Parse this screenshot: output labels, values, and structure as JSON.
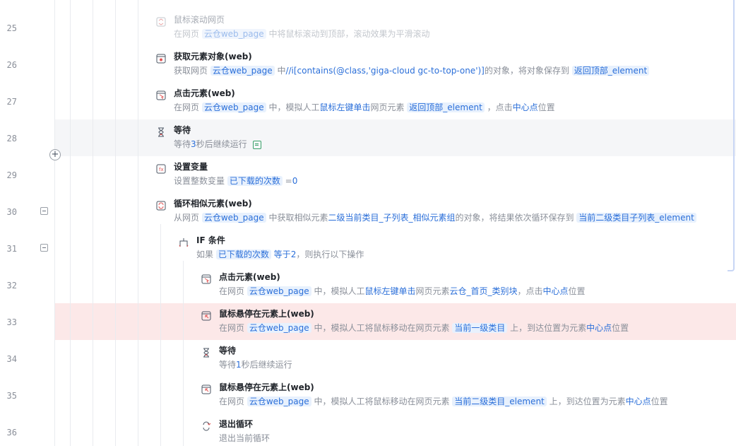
{
  "rows": [
    {
      "line": "25",
      "title": "鼠标滚动网页",
      "icon": "scroll-icon",
      "parts": [
        [
          "t",
          "在网页 "
        ],
        [
          "tag",
          "云仓web_page"
        ],
        [
          "t",
          " 中将鼠标"
        ],
        [
          "hl",
          "滚动到顶部"
        ],
        [
          "t",
          "，滚动效果为"
        ],
        [
          "hl",
          "平滑滚动"
        ]
      ]
    },
    {
      "line": "26",
      "title": "获取元素对象(web)",
      "icon": "get-element-icon",
      "parts": [
        [
          "t",
          "获取网页 "
        ],
        [
          "tag",
          "云仓web_page"
        ],
        [
          "t",
          " 中"
        ],
        [
          "hl",
          "//i[contains(@class,'giga-cloud gc-to-top-one')]"
        ],
        [
          "t",
          "的对象，将对象保存到 "
        ],
        [
          "tag",
          "返回顶部_element"
        ]
      ]
    },
    {
      "line": "27",
      "title": "点击元素(web)",
      "icon": "click-element-icon",
      "parts": [
        [
          "t",
          "在网页 "
        ],
        [
          "tag",
          "云仓web_page"
        ],
        [
          "t",
          " 中，模拟人工"
        ],
        [
          "hl",
          "鼠标左键单击"
        ],
        [
          "t",
          "网页元素 "
        ],
        [
          "tag",
          "返回顶部_element"
        ],
        [
          "t",
          " ，点击"
        ],
        [
          "hl",
          "中心点"
        ],
        [
          "t",
          "位置"
        ]
      ]
    },
    {
      "line": "28",
      "title": "等待",
      "icon": "hourglass-icon",
      "parts": [
        [
          "t",
          "等待"
        ],
        [
          "hl",
          "3"
        ],
        [
          "t",
          "秒后继续运行"
        ]
      ]
    },
    {
      "line": "29",
      "title": "设置变量",
      "icon": "variable-icon",
      "parts": [
        [
          "t",
          "设置整数变量 "
        ],
        [
          "tag",
          "已下载的次数"
        ],
        [
          "t",
          " ="
        ],
        [
          "hl",
          "0"
        ]
      ]
    },
    {
      "line": "30",
      "title": "循环相似元素(web)",
      "icon": "loop-icon",
      "parts": [
        [
          "t",
          "从网页 "
        ],
        [
          "tag",
          "云仓web_page"
        ],
        [
          "t",
          " 中获取相似元素"
        ],
        [
          "hl",
          "二级当前类目_子列表_相似元素组"
        ],
        [
          "t",
          "的对象，将结果依次循环保存到 "
        ],
        [
          "tag",
          "当前二级类目子列表_element"
        ]
      ]
    },
    {
      "line": "31",
      "title": "IF 条件",
      "icon": "if-icon",
      "parts": [
        [
          "t",
          "如果 "
        ],
        [
          "tag",
          "已下载的次数"
        ],
        [
          "t",
          " "
        ],
        [
          "hl",
          "等于"
        ],
        [
          "hl",
          "2"
        ],
        [
          "t",
          "，则执行以下操作"
        ]
      ]
    },
    {
      "line": "32",
      "title": "点击元素(web)",
      "icon": "click-element-icon",
      "parts": [
        [
          "t",
          "在网页 "
        ],
        [
          "tag",
          "云仓web_page"
        ],
        [
          "t",
          " 中，模拟人工"
        ],
        [
          "hl",
          "鼠标左键单击"
        ],
        [
          "t",
          "网页元素"
        ],
        [
          "hl",
          "云仓_首页_类别块"
        ],
        [
          "t",
          "，点击"
        ],
        [
          "hl",
          "中心点"
        ],
        [
          "t",
          "位置"
        ]
      ]
    },
    {
      "line": "33",
      "title": "鼠标悬停在元素上(web)",
      "icon": "hover-icon",
      "parts": [
        [
          "t",
          "在网页 "
        ],
        [
          "tag",
          "云仓web_page"
        ],
        [
          "t",
          " 中，模拟人工将鼠标移动在网页元素 "
        ],
        [
          "tag",
          "当前一级类目"
        ],
        [
          "t",
          " 上，到达位置为元素"
        ],
        [
          "hl",
          "中心点"
        ],
        [
          "t",
          "位置"
        ]
      ]
    },
    {
      "line": "34",
      "title": "等待",
      "icon": "hourglass-icon",
      "parts": [
        [
          "t",
          "等待"
        ],
        [
          "hl",
          "1"
        ],
        [
          "t",
          "秒后继续运行"
        ]
      ]
    },
    {
      "line": "35",
      "title": "鼠标悬停在元素上(web)",
      "icon": "hover-icon",
      "parts": [
        [
          "t",
          "在网页 "
        ],
        [
          "tag",
          "云仓web_page"
        ],
        [
          "t",
          " 中，模拟人工将鼠标移动在网页元素 "
        ],
        [
          "tag",
          "当前二级类目_element"
        ],
        [
          "t",
          " 上，到达位置为元素"
        ],
        [
          "hl",
          "中心点"
        ],
        [
          "t",
          "位置"
        ]
      ]
    },
    {
      "line": "36",
      "title": "退出循环",
      "icon": "exit-loop-icon",
      "parts": [
        [
          "t",
          "退出当前循环"
        ]
      ]
    }
  ],
  "colors": {
    "accent": "#2b6fd9",
    "tag_bg": "#e8f1fd",
    "error_row": "#fce8e8",
    "hover_row": "#f5f6f8"
  }
}
